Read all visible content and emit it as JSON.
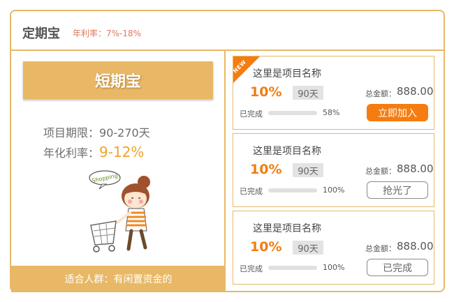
{
  "header": {
    "title": "定期宝",
    "rate_label": "年利率：7%-18%"
  },
  "product": {
    "banner": "短期宝",
    "term_label": "项目期限：",
    "term_value": "90-270天",
    "rate_label": "年化利率：",
    "rate_value": "9-12%",
    "sticker_text": "Shopping",
    "audience": "适合人群：有闲置资金的"
  },
  "colors": {
    "accent": "#e8b866",
    "orange": "#f57c10",
    "rate_text": "#e07a5f"
  },
  "cards": [
    {
      "badge": "NEW",
      "name": "这里是项目名称",
      "rate": "10%",
      "days": "90天",
      "total_label": "总金额：",
      "total_value": "888.00",
      "done_label": "已完成",
      "progress": 0.58,
      "percent": "58%",
      "button": "立即加入",
      "button_style": "primary"
    },
    {
      "badge": "",
      "name": "这里是项目名称",
      "rate": "10%",
      "days": "90天",
      "total_label": "总金额：",
      "total_value": "888.00",
      "done_label": "已完成",
      "progress": 1.0,
      "percent": "100%",
      "button": "抢光了",
      "button_style": "outline"
    },
    {
      "badge": "",
      "name": "这里是项目名称",
      "rate": "10%",
      "days": "90天",
      "total_label": "总金额：",
      "total_value": "888.00",
      "done_label": "已完成",
      "progress": 1.0,
      "percent": "100%",
      "button": "已完成",
      "button_style": "outline"
    }
  ]
}
